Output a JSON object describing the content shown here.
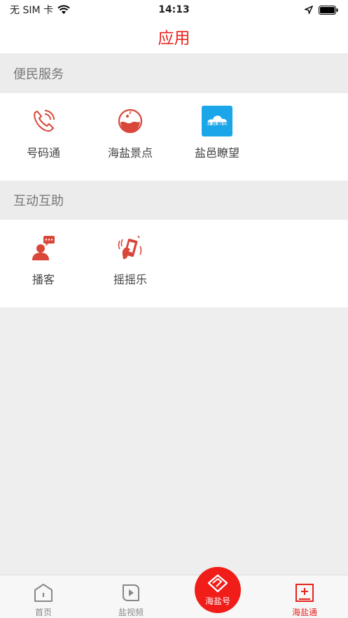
{
  "status_bar": {
    "carrier": "无 SIM 卡",
    "time": "14:13"
  },
  "header": {
    "title": "应用"
  },
  "sections": [
    {
      "title": "便民服务",
      "items": [
        {
          "label": "号码通"
        },
        {
          "label": "海盐景点"
        },
        {
          "label": "盐邑瞭望",
          "icon_text": "盐邑瞭望"
        }
      ]
    },
    {
      "title": "互动互助",
      "items": [
        {
          "label": "播客"
        },
        {
          "label": "摇摇乐"
        }
      ]
    }
  ],
  "tabbar": {
    "home": "首页",
    "video": "盐视频",
    "center": "海盐号",
    "service": "海盐通"
  },
  "colors": {
    "accent": "#e8231d",
    "icon_red": "#d9473a",
    "icon_blue": "#1aa6e8"
  }
}
